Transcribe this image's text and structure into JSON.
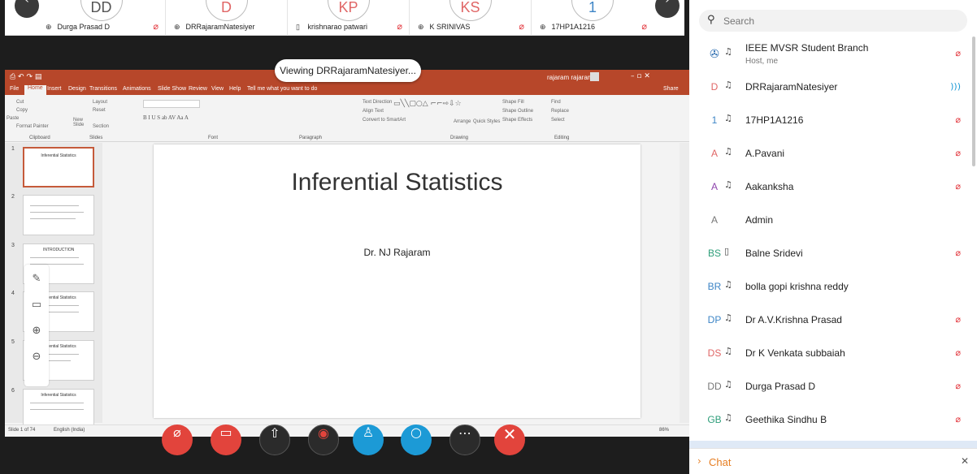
{
  "strip": {
    "participants": [
      {
        "initials": "DD",
        "name": "Durga Prasad D"
      },
      {
        "initials": "D",
        "name": "DRRajaramNatesiyer"
      },
      {
        "initials": "KP",
        "name": "krishnarao patwari"
      },
      {
        "initials": "KS",
        "name": "K SRINIVAS"
      },
      {
        "initials": "1",
        "name": "17HP1A1216"
      }
    ]
  },
  "viewing_label": "Viewing DRRajaramNatesiyer...",
  "ppt": {
    "user": "rajaram rajaram",
    "tabs": [
      "File",
      "Home",
      "Insert",
      "Design",
      "Transitions",
      "Animations",
      "Slide Show",
      "Review",
      "View",
      "Help",
      "Tell me what you want to do"
    ],
    "share": "Share",
    "ribbon_groups": [
      "Clipboard",
      "Slides",
      "Font",
      "Paragraph",
      "Drawing",
      "Editing"
    ],
    "ribbon_items": {
      "cut": "Cut",
      "copy": "Copy",
      "paste": "Paste",
      "format_painter": "Format Painter",
      "layout": "Layout",
      "reset": "Reset",
      "new_slide": "New Slide",
      "section": "Section",
      "text_direction": "Text Direction",
      "align_text": "Align Text",
      "convert": "Convert to SmartArt",
      "arrange": "Arrange",
      "quick_styles": "Quick Styles",
      "shape_fill": "Shape Fill",
      "shape_outline": "Shape Outline",
      "shape_effects": "Shape Effects",
      "find": "Find",
      "replace": "Replace",
      "select": "Select"
    },
    "slide_thumbs": [
      {
        "num": "1",
        "title": "Inferential Statistics"
      },
      {
        "num": "2",
        "title": ""
      },
      {
        "num": "3",
        "title": "INTRODUCTION"
      },
      {
        "num": "4",
        "title": "Inferential Statistics"
      },
      {
        "num": "5",
        "title": "Inferential Statistics"
      },
      {
        "num": "6",
        "title": "Inferential Statistics"
      }
    ],
    "slide": {
      "title": "Inferential Statistics",
      "subtitle": "Dr. NJ Rajaram"
    },
    "status": {
      "slide": "Slide 1 of 74",
      "lang": "English (India)",
      "zoom": "86%"
    }
  },
  "panel": {
    "search_placeholder": "Search",
    "participants": [
      {
        "initials": "",
        "name": "IEEE MVSR Student Branch",
        "sub": "Host, me",
        "color": "#2b6cb0"
      },
      {
        "initials": "D",
        "name": "DRRajaramNatesiyer",
        "sub": "",
        "color": "#e06666"
      },
      {
        "initials": "1",
        "name": "17HP1A1216",
        "sub": "",
        "color": "#3d85c6"
      },
      {
        "initials": "A",
        "name": "A.Pavani",
        "sub": "",
        "color": "#e06666"
      },
      {
        "initials": "A",
        "name": "Aakanksha",
        "sub": "",
        "color": "#8e44ad"
      },
      {
        "initials": "A",
        "name": "Admin",
        "sub": "",
        "color": "#777777"
      },
      {
        "initials": "BS",
        "name": "Balne Sridevi",
        "sub": "",
        "color": "#2e9e7a"
      },
      {
        "initials": "BR",
        "name": "bolla gopi krishna reddy",
        "sub": "",
        "color": "#3d85c6"
      },
      {
        "initials": "DP",
        "name": "Dr A.V.Krishna Prasad",
        "sub": "",
        "color": "#3d85c6"
      },
      {
        "initials": "DS",
        "name": "Dr K Venkata subbaiah",
        "sub": "",
        "color": "#e06666"
      },
      {
        "initials": "DD",
        "name": "Durga Prasad D",
        "sub": "",
        "color": "#777777"
      },
      {
        "initials": "GB",
        "name": "Geethika Sindhu B",
        "sub": "",
        "color": "#2e9e7a"
      }
    ],
    "chat_label": "Chat"
  }
}
